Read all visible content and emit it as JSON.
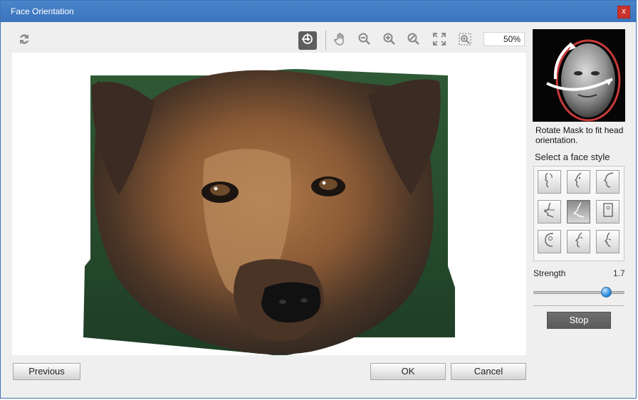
{
  "window": {
    "title": "Face Orientation",
    "close_label": "x"
  },
  "toolbar": {
    "zoom_value": "50%",
    "tools": [
      "reset-icon",
      "rotate-mask-icon",
      "hand-icon",
      "zoom-out-icon",
      "zoom-in-icon",
      "zoom-reset-icon",
      "fit-screen-icon",
      "actual-size-icon"
    ]
  },
  "side": {
    "hint": "Rotate Mask to fit head orientation.",
    "style_title": "Select a face style",
    "strength_label": "Strength",
    "strength_value": "1.7",
    "strength_level": 0.85,
    "stop_label": "Stop"
  },
  "face_styles": {
    "count": 9,
    "selected_index": 4
  },
  "footer": {
    "previous_label": "Previous",
    "ok_label": "OK",
    "cancel_label": "Cancel"
  },
  "colors": {
    "titlebar": "#3a74bd",
    "accent_blue": "#2f8dde",
    "close": "#c9332c"
  }
}
